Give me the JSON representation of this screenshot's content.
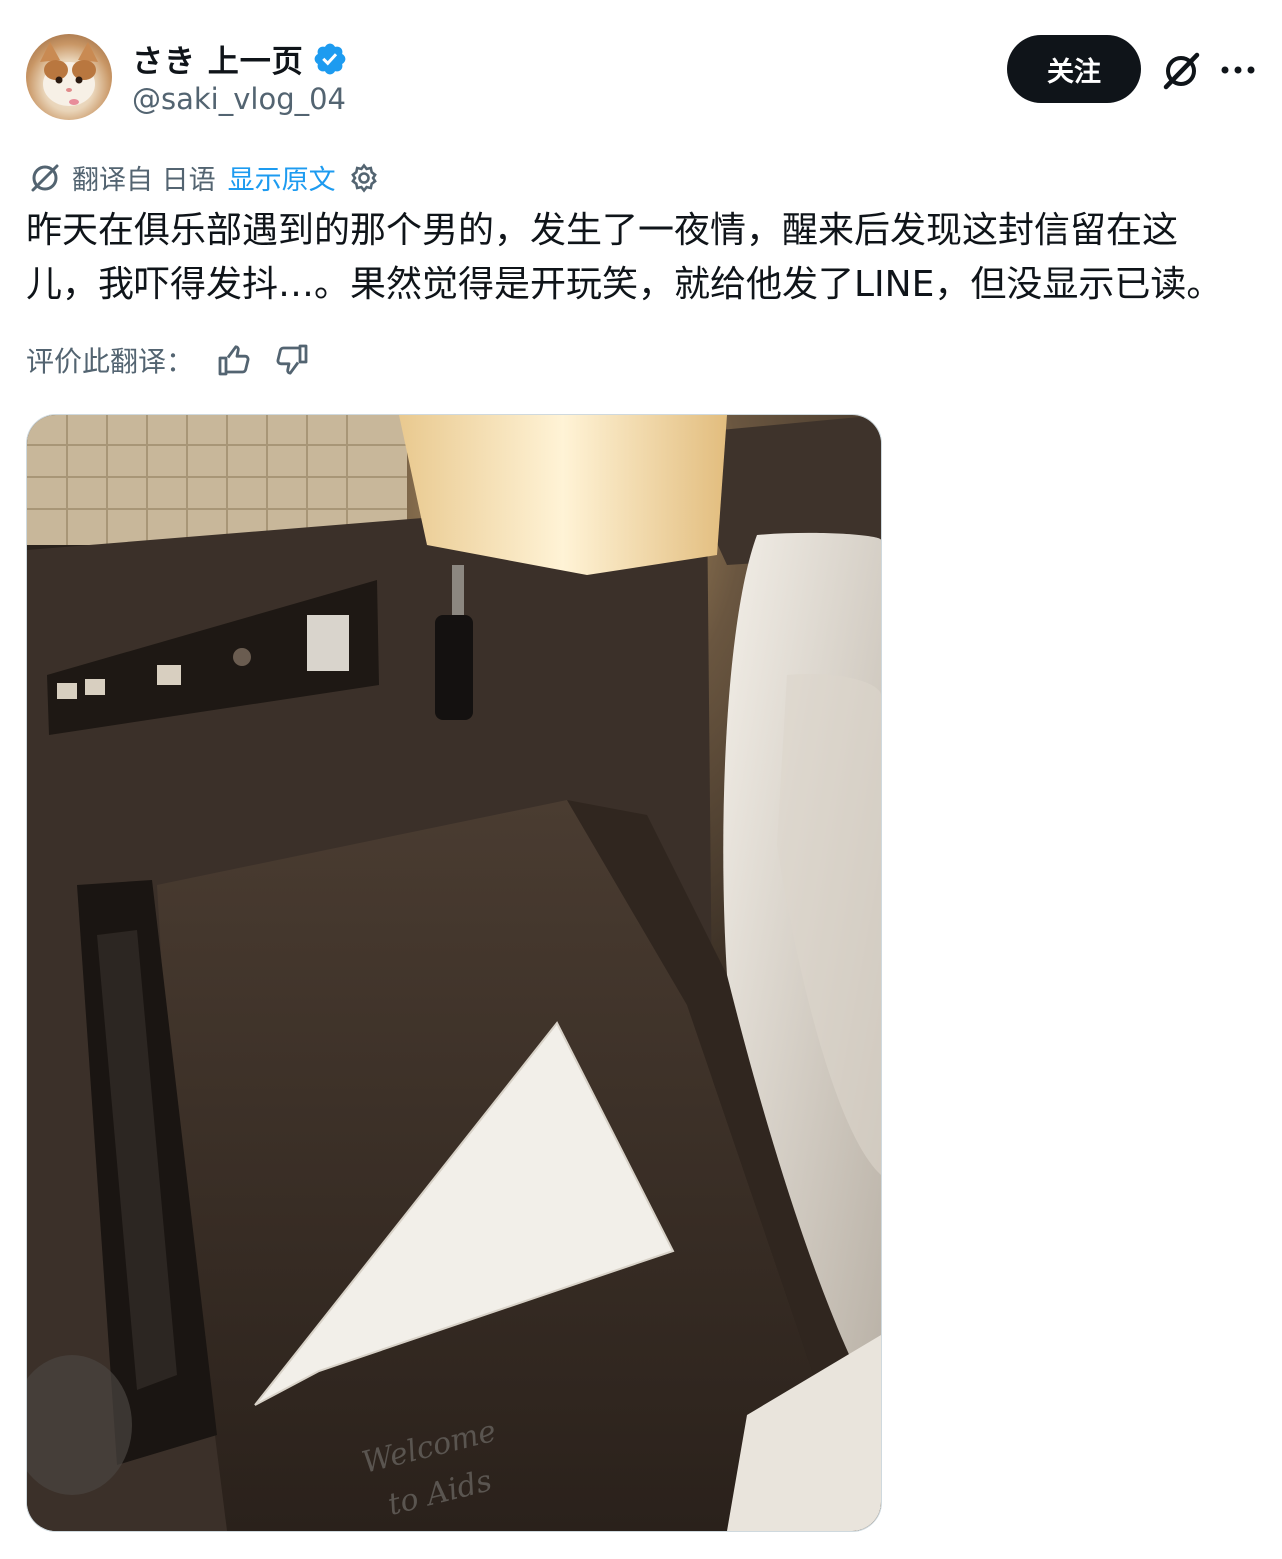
{
  "header": {
    "display_name": "さき 上一页",
    "handle": "@saki_vlog_04",
    "follow_label": "关注",
    "avatar_icon": "cat-avatar",
    "verified_icon": "verified-badge-icon",
    "grok_icon": "grok-icon",
    "more_icon": "more-dots-icon"
  },
  "translation": {
    "source_label": "翻译自 日语",
    "show_original_label": "显示原文",
    "rate_label": "评价此翻译："
  },
  "tweet": {
    "text": "昨天在俱乐部遇到的那个男的，发生了一夜情，醒来后发现这封信留在这儿，我吓得发抖…。果然觉得是开玩笑，就给他发了LINE，但没显示已读。"
  },
  "media": {
    "note_line1": "Welcome",
    "note_line2": "to Aids"
  },
  "colors": {
    "link": "#1d9bf0",
    "muted": "#536471",
    "verified": "#1d9bf0",
    "button_bg": "#0f1419"
  }
}
